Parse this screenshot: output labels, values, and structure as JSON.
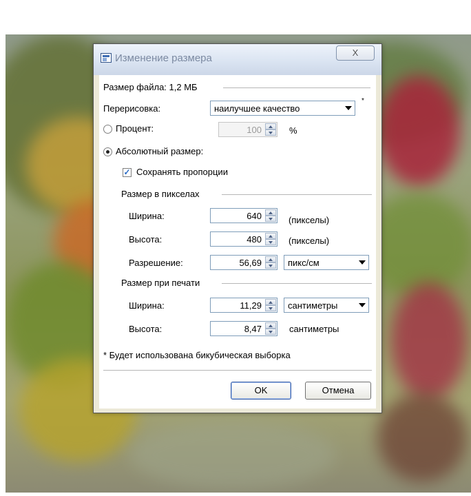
{
  "dialog": {
    "title": "Изменение размера",
    "close_label": "X",
    "file_size_label": "Размер файла: 1,2 МБ",
    "resample": {
      "label": "Перерисовка:",
      "value": "наилучшее качество",
      "note": "*"
    },
    "percent": {
      "label": "Процент:",
      "value": "100",
      "unit": "%",
      "selected": false
    },
    "absolute": {
      "label": "Абсолютный размер:",
      "selected": true
    },
    "keep_ratio": {
      "label": "Сохранять пропорции",
      "checked": true
    },
    "pixel_size": {
      "header": "Размер в пикселах",
      "width": {
        "label": "Ширина:",
        "value": "640",
        "unit": "(пикселы)"
      },
      "height": {
        "label": "Высота:",
        "value": "480",
        "unit": "(пикселы)"
      },
      "resolution": {
        "label": "Разрешение:",
        "value": "56,69",
        "unit": "пикс/см"
      }
    },
    "print_size": {
      "header": "Размер при печати",
      "width": {
        "label": "Ширина:",
        "value": "11,29",
        "unit": "сантиметры"
      },
      "height": {
        "label": "Высота:",
        "value": "8,47",
        "unit": "сантиметры"
      }
    },
    "footnote": "* Будет использована бикубическая выборка",
    "ok_label": "OK",
    "cancel_label": "Отмена"
  },
  "colors": {
    "accent": "#3e6cb3",
    "title_text": "#7c8aa2",
    "face": "#ece9d8"
  },
  "icons": {
    "title": "image-app-icon",
    "close": "close-icon",
    "spin": "spin-arrow-icon",
    "dropdown": "chevron-down-icon"
  }
}
